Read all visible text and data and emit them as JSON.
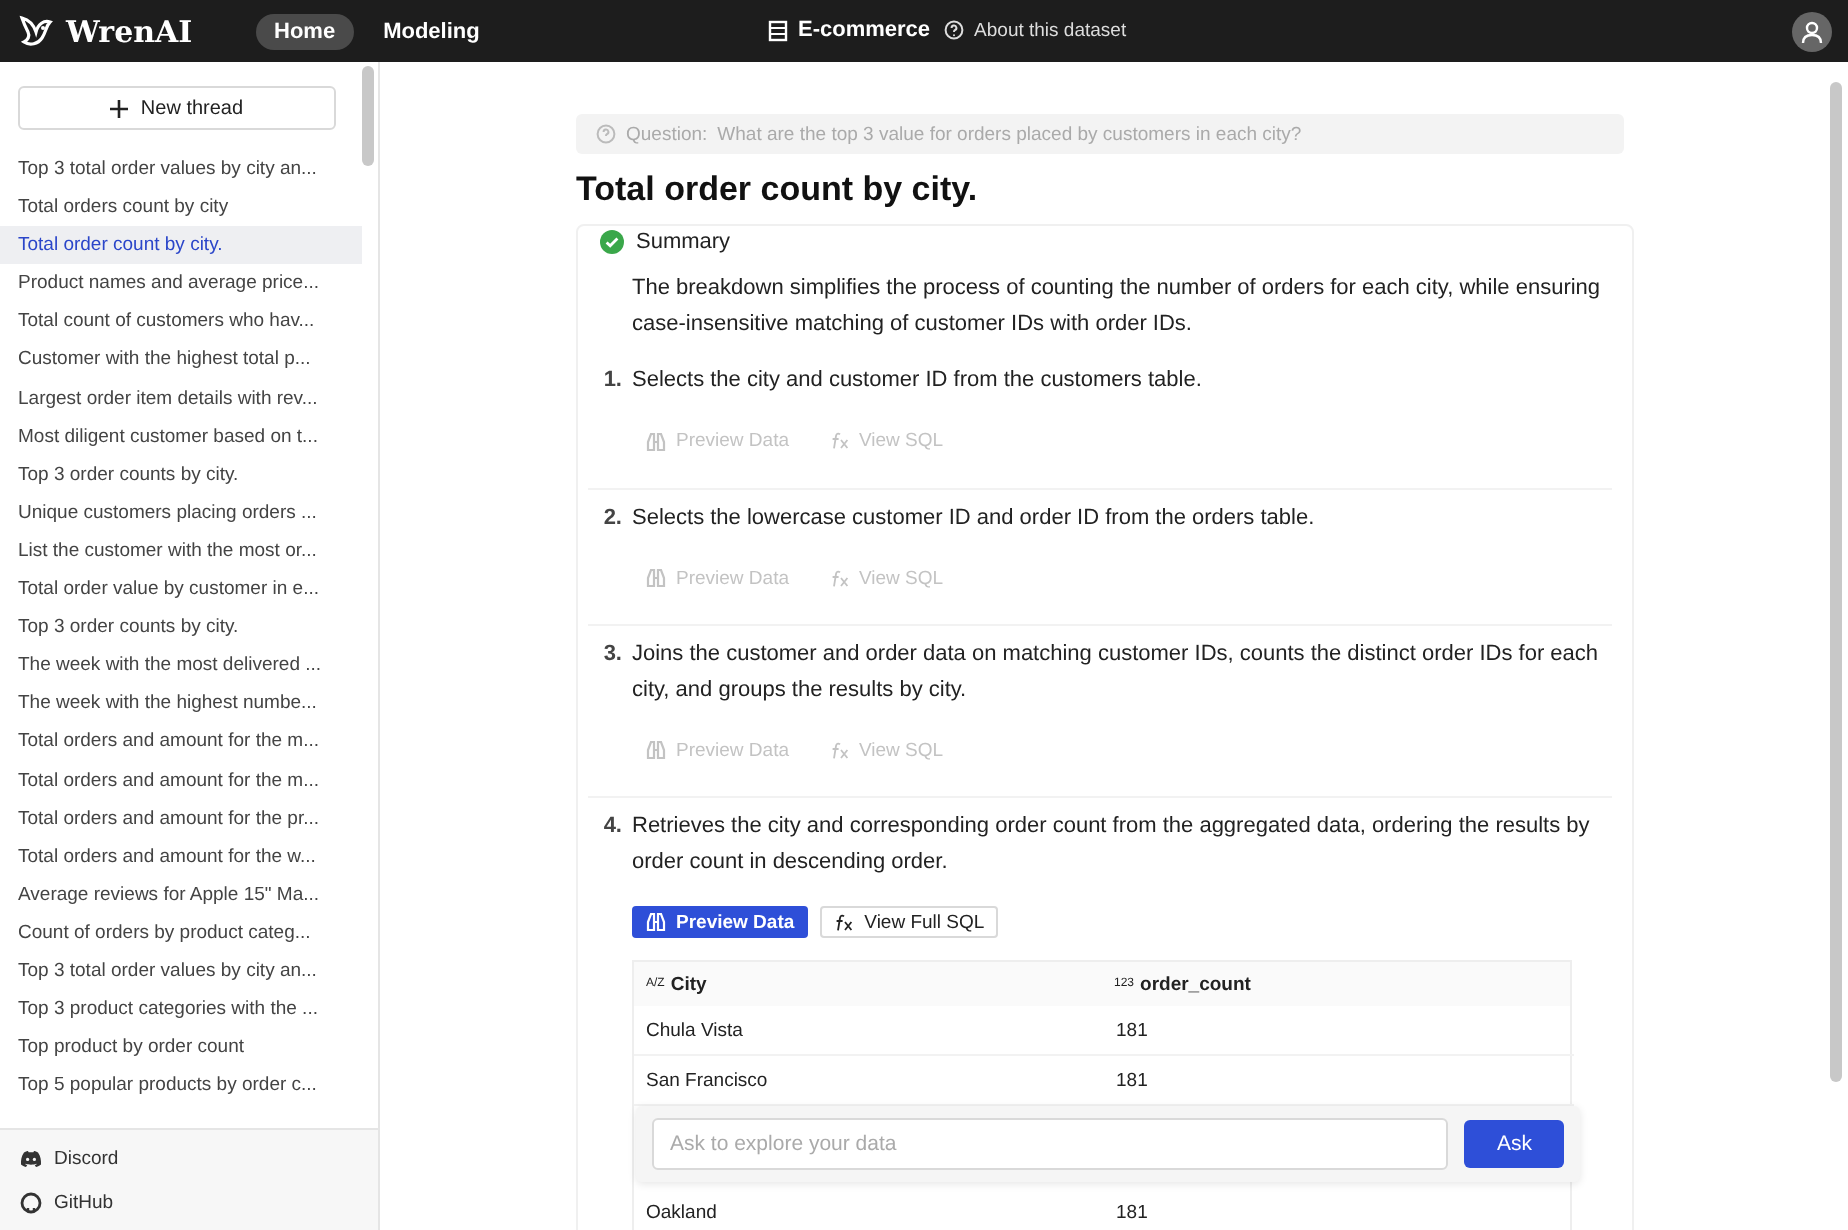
{
  "header": {
    "logo": "WrenAI",
    "nav": [
      {
        "label": "Home",
        "selected": true
      },
      {
        "label": "Modeling",
        "selected": false
      }
    ],
    "dataset": "E-commerce",
    "about": "About this dataset"
  },
  "sidebar": {
    "new_thread": "New thread",
    "threads": [
      {
        "label": "Top 3 total order values by city an...",
        "selected": false
      },
      {
        "label": "Total orders count by city",
        "selected": false
      },
      {
        "label": "Total order count by city.",
        "selected": true
      },
      {
        "label": "Product names and average price...",
        "selected": false
      },
      {
        "label": "Total count of customers who hav...",
        "selected": false
      },
      {
        "label": "Customer with the highest total p...",
        "selected": false
      },
      {
        "label": "Largest order item details with rev...",
        "selected": false
      },
      {
        "label": "Most diligent customer based on t...",
        "selected": false
      },
      {
        "label": "Top 3 order counts by city.",
        "selected": false
      },
      {
        "label": "Unique customers placing orders ...",
        "selected": false
      },
      {
        "label": "List the customer with the most or...",
        "selected": false
      },
      {
        "label": "Total order value by customer in e...",
        "selected": false
      },
      {
        "label": "Top 3 order counts by city.",
        "selected": false
      },
      {
        "label": "The week with the most delivered ...",
        "selected": false
      },
      {
        "label": "The week with the highest numbe...",
        "selected": false
      },
      {
        "label": "Total orders and amount for the m...",
        "selected": false
      },
      {
        "label": "Total orders and amount for the m...",
        "selected": false
      },
      {
        "label": "Total orders and amount for the pr...",
        "selected": false
      },
      {
        "label": "Total orders and amount for the w...",
        "selected": false
      },
      {
        "label": "Average reviews for Apple 15\" Ma...",
        "selected": false
      },
      {
        "label": "Count of orders by product categ...",
        "selected": false
      },
      {
        "label": "Top 3 total order values by city an...",
        "selected": false
      },
      {
        "label": "Top 3 product categories with the ...",
        "selected": false
      },
      {
        "label": "Top product by order count",
        "selected": false
      },
      {
        "label": "Top 5 popular products by order c...",
        "selected": false
      }
    ],
    "links": [
      {
        "kind": "discord",
        "label": "Discord"
      },
      {
        "kind": "github",
        "label": "GitHub"
      }
    ]
  },
  "question": {
    "label": "Question:",
    "text": "What are the top 3 value for orders placed by customers in each city?"
  },
  "title": "Total order count by city.",
  "summary": {
    "label": "Summary",
    "text": "The breakdown simplifies the process of counting the number of orders for each city, while ensuring case-insensitive matching of customer IDs with order IDs."
  },
  "steps": [
    {
      "number": "1.",
      "text": "Selects the city and customer ID from the customers table.",
      "buttons": [
        {
          "kind": "faint",
          "label": "Preview Data"
        },
        {
          "kind": "faint",
          "label": "View SQL"
        }
      ]
    },
    {
      "number": "2.",
      "text": "Selects the lowercase customer ID and order ID from the orders table.",
      "buttons": [
        {
          "kind": "faint",
          "label": "Preview Data"
        },
        {
          "kind": "faint",
          "label": "View SQL"
        }
      ]
    },
    {
      "number": "3.",
      "text": "Joins the customer and order data on matching customer IDs, counts the distinct order IDs for each city, and groups the results by city.",
      "buttons": [
        {
          "kind": "faint",
          "label": "Preview Data"
        },
        {
          "kind": "faint",
          "label": "View SQL"
        }
      ]
    },
    {
      "number": "4.",
      "text": "Retrieves the city and corresponding order count from the aggregated data, ordering the results by order count in descending order.",
      "buttons": [
        {
          "kind": "primary",
          "label": "Preview Data"
        },
        {
          "kind": "outline",
          "label": "View Full SQL"
        }
      ],
      "table": {
        "columns": [
          {
            "type_icon": "A/Z",
            "label": "City"
          },
          {
            "type_icon": "123",
            "label": "order_count"
          }
        ],
        "rows": [
          [
            "Chula Vista",
            "181"
          ],
          [
            "San Francisco",
            "181"
          ],
          [
            "Oakland",
            "181"
          ]
        ]
      }
    }
  ],
  "ask": {
    "placeholder": "Ask to explore your data",
    "button": "Ask"
  }
}
